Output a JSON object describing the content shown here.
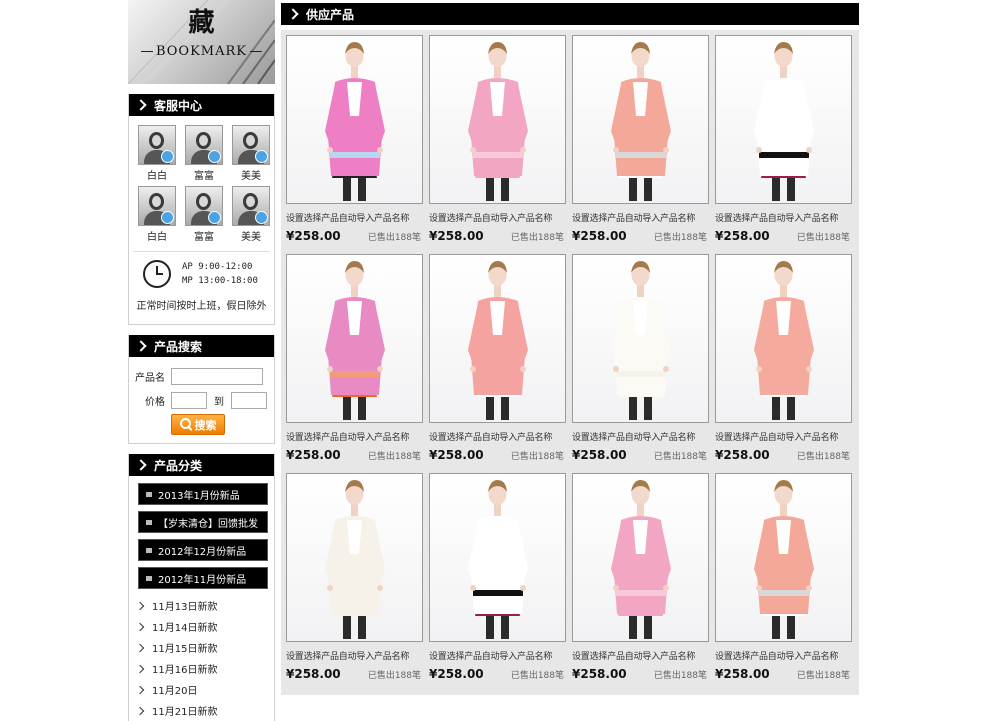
{
  "bookmark": {
    "han": "藏",
    "word": "BOOKMARK"
  },
  "service": {
    "title": "客服中心",
    "agents": [
      {
        "name": "白白"
      },
      {
        "name": "富富"
      },
      {
        "name": "美美"
      },
      {
        "name": "白白"
      },
      {
        "name": "富富"
      },
      {
        "name": "美美"
      }
    ],
    "hours_am": "AP 9:00-12:00",
    "hours_pm": "MP 13:00-18:00",
    "note": "正常时间按时上班，假日除外"
  },
  "search": {
    "title": "产品搜索",
    "name_label": "产品名",
    "price_label": "价格",
    "to_label": "到",
    "button": "搜索"
  },
  "category": {
    "title": "产品分类",
    "items": [
      "2013年1月份新品",
      "【岁末清仓】回馈批发",
      "2012年12月份新品",
      "2012年11月份新品"
    ],
    "subs": [
      "11月13日新款",
      "11月14日新款",
      "11月15日新款",
      "11月16日新款",
      "11月20日",
      "11月21日新款"
    ]
  },
  "products": {
    "title": "供应产品",
    "items": [
      {
        "title": "设置选择产品自动导入产品名称",
        "price": "¥258.00",
        "sold": "已售出188笔",
        "coat": "#ee7fc4",
        "accent": "#b7d7f0",
        "skirt": "#222222"
      },
      {
        "title": "设置选择产品自动导入产品名称",
        "price": "¥258.00",
        "sold": "已售出188笔",
        "coat": "#f3a6c3",
        "accent": "#f7c9da",
        "skirt": "#f3a6c3"
      },
      {
        "title": "设置选择产品自动导入产品名称",
        "price": "¥258.00",
        "sold": "已售出188笔",
        "coat": "#f4a89a",
        "accent": "#d8d8d8",
        "skirt": "#ffffff"
      },
      {
        "title": "设置选择产品自动导入产品名称",
        "price": "¥258.00",
        "sold": "已售出188笔",
        "coat": "#ffffff",
        "accent": "#111111",
        "skirt": "#9c1c4e"
      },
      {
        "title": "设置选择产品自动导入产品名称",
        "price": "¥258.00",
        "sold": "已售出188笔",
        "coat": "#e88ac4",
        "accent": "#f29c7c",
        "skirt": "#f06a1f"
      },
      {
        "title": "设置选择产品自动导入产品名称",
        "price": "¥258.00",
        "sold": "已售出188笔",
        "coat": "#f4a3a0",
        "accent": "#f4a3a0",
        "skirt": "#ffffff"
      },
      {
        "title": "设置选择产品自动导入产品名称",
        "price": "¥258.00",
        "sold": "已售出188笔",
        "coat": "#fbfaf4",
        "accent": "#f5f3ea",
        "skirt": "#fbfaf4"
      },
      {
        "title": "设置选择产品自动导入产品名称",
        "price": "¥258.00",
        "sold": "已售出188笔",
        "coat": "#f4aa9c",
        "accent": "#f4aa9c",
        "skirt": "#ffffff"
      },
      {
        "title": "设置选择产品自动导入产品名称",
        "price": "¥258.00",
        "sold": "已售出188笔",
        "coat": "#f6f2ea",
        "accent": "#f6f2ea",
        "skirt": "#f6f2ea"
      },
      {
        "title": "设置选择产品自动导入产品名称",
        "price": "¥258.00",
        "sold": "已售出188笔",
        "coat": "#ffffff",
        "accent": "#111111",
        "skirt": "#9c1c4e"
      },
      {
        "title": "设置选择产品自动导入产品名称",
        "price": "¥258.00",
        "sold": "已售出188笔",
        "coat": "#f3a6c3",
        "accent": "#f7c9da",
        "skirt": "#f3a6c3"
      },
      {
        "title": "设置选择产品自动导入产品名称",
        "price": "¥258.00",
        "sold": "已售出188笔",
        "coat": "#f4a89a",
        "accent": "#d8d8d8",
        "skirt": "#ffffff"
      }
    ]
  }
}
